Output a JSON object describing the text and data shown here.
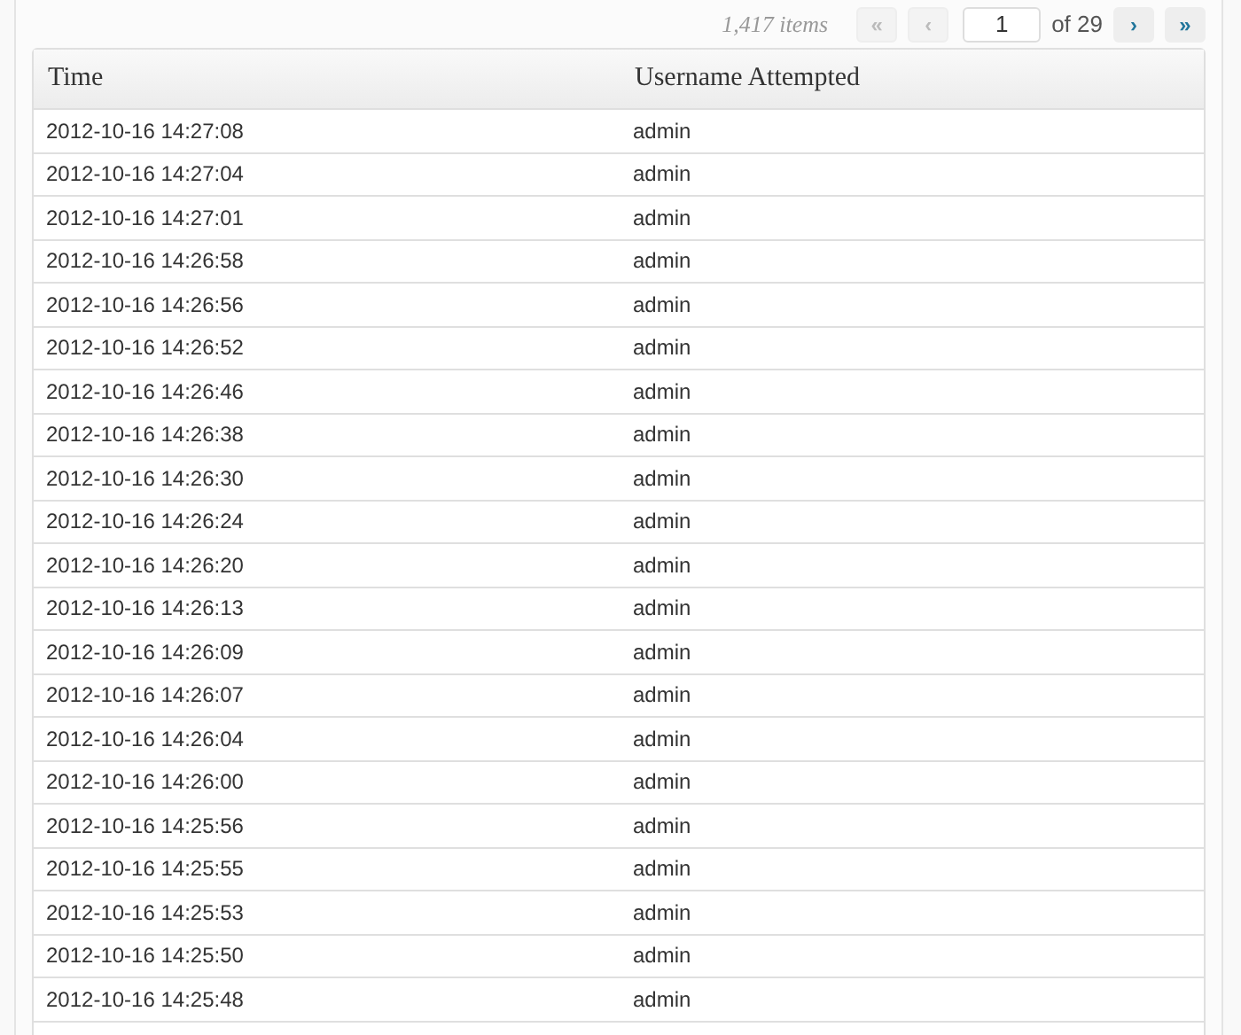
{
  "pagination": {
    "item_count": "1,417 items",
    "buttons": [
      {
        "label": "«",
        "disabled": true
      },
      {
        "label": "‹",
        "disabled": true
      }
    ],
    "page_value": "1",
    "total": "of 29",
    "next_buttons": [
      {
        "label": "›",
        "disabled": false
      },
      {
        "label": "»",
        "disabled": false
      }
    ]
  },
  "table": {
    "columns": [
      "Time",
      "Username Attempted"
    ],
    "rows": [
      [
        "2012-10-16 14:27:08",
        "admin"
      ],
      [
        "2012-10-16 14:27:04",
        "admin"
      ],
      [
        "2012-10-16 14:27:01",
        "admin"
      ],
      [
        "2012-10-16 14:26:58",
        "admin"
      ],
      [
        "2012-10-16 14:26:56",
        "admin"
      ],
      [
        "2012-10-16 14:26:52",
        "admin"
      ],
      [
        "2012-10-16 14:26:46",
        "admin"
      ],
      [
        "2012-10-16 14:26:38",
        "admin"
      ],
      [
        "2012-10-16 14:26:30",
        "admin"
      ],
      [
        "2012-10-16 14:26:24",
        "admin"
      ],
      [
        "2012-10-16 14:26:20",
        "admin"
      ],
      [
        "2012-10-16 14:26:13",
        "admin"
      ],
      [
        "2012-10-16 14:26:09",
        "admin"
      ],
      [
        "2012-10-16 14:26:07",
        "admin"
      ],
      [
        "2012-10-16 14:26:04",
        "admin"
      ],
      [
        "2012-10-16 14:26:00",
        "admin"
      ],
      [
        "2012-10-16 14:25:56",
        "admin"
      ],
      [
        "2012-10-16 14:25:55",
        "admin"
      ],
      [
        "2012-10-16 14:25:53",
        "admin"
      ],
      [
        "2012-10-16 14:25:50",
        "admin"
      ],
      [
        "2012-10-16 14:25:48",
        "admin"
      ]
    ]
  }
}
